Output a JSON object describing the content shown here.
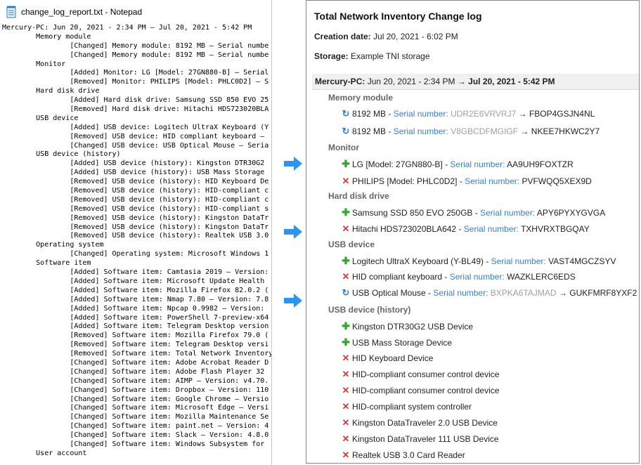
{
  "notepad": {
    "title": "change_log_report.txt - Notepad",
    "lines": [
      "Mercury-PC: Jun 20, 2021 - 2:34 PM — Jul 20, 2021 - 5:42 PM",
      "        Memory module",
      "                [Changed] Memory module: 8192 MB — Serial numbe",
      "                [Changed] Memory module: 8192 MB — Serial numbe",
      "        Monitor",
      "                [Added] Monitor: LG [Model: 27GN880-B] — Serial",
      "                [Removed] Monitor: PHILIPS [Model: PHLC0D2] — S",
      "        Hard disk drive",
      "                [Added] Hard disk drive: Samsung SSD 850 EVO 25",
      "                [Removed] Hard disk drive: Hitachi HDS723020BLA",
      "        USB device",
      "                [Added] USB device: Logitech UltraX Keyboard (Y",
      "                [Removed] USB device: HID compliant keyboard — ",
      "                [Changed] USB device: USB Optical Mouse — Seria",
      "        USB device (history)",
      "                [Added] USB device (history): Kingston DTR30G2 ",
      "                [Added] USB device (history): USB Mass Storage ",
      "                [Removed] USB device (history): HID Keyboard De",
      "                [Removed] USB device (history): HID-compliant c",
      "                [Removed] USB device (history): HID-compliant c",
      "                [Removed] USB device (history): HID-compliant s",
      "                [Removed] USB device (history): Kingston DataTr",
      "                [Removed] USB device (history): Kingston DataTr",
      "                [Removed] USB device (history): Realtek USB 3.0",
      "        Operating system",
      "                [Changed] Operating system: Microsoft Windows 1",
      "        Software item",
      "                [Added] Software item: Camtasia 2019 — Version:",
      "                [Added] Software item: Microsoft Update Health ",
      "                [Added] Software item: Mozilla Firefox 82.0.2 (",
      "                [Added] Software item: Nmap 7.80 — Version: 7.8",
      "                [Added] Software item: Npcap 0.9982 — Version: ",
      "                [Added] Software item: PowerShell 7-preview-x64",
      "                [Added] Software item: Telegram Desktop version",
      "                [Removed] Software item: Mozilla Firefox 79.0 (",
      "                [Removed] Software item: Telegram Desktop versi",
      "                [Removed] Software item: Total Network Inventory",
      "                [Changed] Software item: Adobe Acrobat Reader D",
      "                [Changed] Software item: Adobe Flash Player 32 ",
      "                [Changed] Software item: AIMP — Version: v4.70.",
      "                [Changed] Software item: Dropbox — Version: 110",
      "                [Changed] Software item: Google Chrome — Versio",
      "                [Changed] Software item: Microsoft Edge — Versi",
      "                [Changed] Software item: Mozilla Maintenance Se",
      "                [Changed] Software item: paint.net — Version: 4",
      "                [Changed] Software item: Slack — Version: 4.8.0",
      "                [Changed] Software item: Windows Subsystem for ",
      "        User account"
    ]
  },
  "report": {
    "title": "Total Network Inventory Change log",
    "creation_label": "Creation date:",
    "creation_value": "Jul 20, 2021 - 6:02 PM",
    "storage_label": "Storage:",
    "storage_value": "Example TNI storage",
    "section": {
      "host": "Mercury-PC:",
      "from": "Jun 20, 2021 - 2:34 PM",
      "arrow": "→",
      "to": "Jul 20, 2021 - 5:42 PM"
    },
    "categories": [
      {
        "name": "Memory module",
        "items": [
          {
            "type": "changed",
            "text": "8192 MB -",
            "sn_label": "Serial number:",
            "old": "UDR2E6VRVRJ7",
            "arrow": "→",
            "value": "FBOP4GSJN4NL"
          },
          {
            "type": "changed",
            "text": "8192 MB -",
            "sn_label": "Serial number:",
            "old": "V8GBCDFMGIGF",
            "arrow": "→",
            "value": "NKEE7HKWC2Y7"
          }
        ]
      },
      {
        "name": "Monitor",
        "items": [
          {
            "type": "added",
            "text": "LG [Model: 27GN880-B] -",
            "sn_label": "Serial number:",
            "value": "AA9UH9FOXTZR"
          },
          {
            "type": "removed",
            "text": "PHILIPS [Model: PHLC0D2] -",
            "sn_label": "Serial number:",
            "value": "PVFWQQ5XEX9D"
          }
        ]
      },
      {
        "name": "Hard disk drive",
        "items": [
          {
            "type": "added",
            "text": "Samsung SSD 850 EVO 250GB -",
            "sn_label": "Serial number:",
            "value": "APY6PYXYGVGA"
          },
          {
            "type": "removed",
            "text": "Hitachi HDS723020BLA642 -",
            "sn_label": "Serial number:",
            "value": "TXHVRXTBGQAY"
          }
        ]
      },
      {
        "name": "USB device",
        "items": [
          {
            "type": "added",
            "text": "Logitech UltraX Keyboard (Y-BL49) -",
            "sn_label": "Serial number:",
            "value": "VAST4MGCZSYV"
          },
          {
            "type": "removed",
            "text": "HID compliant keyboard -",
            "sn_label": "Serial number:",
            "value": "WAZKLERC6EDS"
          },
          {
            "type": "changed",
            "text": "USB Optical Mouse -",
            "sn_label": "Serial number:",
            "old": "BXPKA6TAJMAD",
            "arrow": "→",
            "value": "GUKFMRF8YXF2"
          }
        ]
      },
      {
        "name": "USB device (history)",
        "items": [
          {
            "type": "added",
            "text": "Kingston DTR30G2 USB Device"
          },
          {
            "type": "added",
            "text": "USB Mass Storage Device"
          },
          {
            "type": "removed",
            "text": "HID Keyboard Device"
          },
          {
            "type": "removed",
            "text": "HID-compliant consumer control device"
          },
          {
            "type": "removed",
            "text": "HID-compliant consumer control device"
          },
          {
            "type": "removed",
            "text": "HID-compliant system controller"
          },
          {
            "type": "removed",
            "text": "Kingston DataTraveler 2.0 USB Device"
          },
          {
            "type": "removed",
            "text": "Kingston DataTraveler 111 USB Device"
          },
          {
            "type": "removed",
            "text": "Realtek USB 3.0 Card Reader"
          }
        ]
      }
    ]
  },
  "icons": {
    "added": "plus-icon",
    "removed": "cross-icon",
    "changed": "refresh-icon",
    "arrow": "right-arrow-icon"
  },
  "colors": {
    "added": "#2ea82e",
    "removed": "#d43a3a",
    "changed": "#2f7fd3",
    "serial_label": "#3b7fd1",
    "old_value": "#a0a0a0",
    "arrow": "#2f95e8"
  }
}
